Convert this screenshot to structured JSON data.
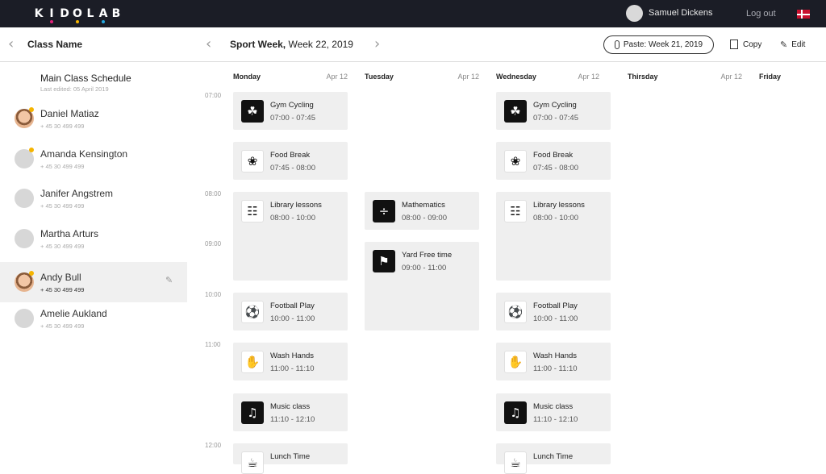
{
  "header": {
    "logo_letters": [
      "K",
      "I",
      "D",
      "O",
      "L",
      "A",
      "B"
    ],
    "user_name": "Samuel Dickens",
    "logout_label": "Log out",
    "colors": {
      "topbar": "#1b1d26",
      "logo_pink": "#e2227a",
      "logo_yellow": "#f5b400",
      "logo_blue": "#25a9e0",
      "flag": "#c8102e"
    }
  },
  "subbar": {
    "back_icon": "chevron-left-icon",
    "class_name": "Class Name",
    "week_bold": "Sport Week,",
    "week_rest": " Week 22, 2019",
    "paste_label": "Paste: Week 21, 2019",
    "copy_label": "Copy",
    "edit_label": "Edit"
  },
  "sidebar": {
    "main_title": "Main Class Schedule",
    "main_subtitle": "Last edited: 05 April 2019",
    "children": [
      {
        "name": "Daniel Matiaz",
        "phone": "+ 45 30 499 499"
      },
      {
        "name": "Amanda Kensington",
        "phone": "+ 45 30 499 499"
      },
      {
        "name": "Janifer Angstrem",
        "phone": "+ 45 30 499 499"
      },
      {
        "name": "Martha Arturs",
        "phone": "+ 45 30 499 499"
      },
      {
        "name": "Andy Bull",
        "phone": "+ 45 30 499 499"
      },
      {
        "name": "Amelie Aukland",
        "phone": "+ 45 30 499 499"
      }
    ]
  },
  "times": [
    "07:00",
    "08:00",
    "09:00",
    "10:00",
    "11:00",
    "12:00"
  ],
  "days": [
    {
      "name": "Monday",
      "date": "Apr 12"
    },
    {
      "name": "Tuesday",
      "date": "Apr 12"
    },
    {
      "name": "Wednesday",
      "date": "Apr 12"
    },
    {
      "name": "Thirsday",
      "date": "Apr 12"
    },
    {
      "name": "Friday",
      "date": ""
    }
  ],
  "events": {
    "monday": [
      {
        "name": "Gym Cycling",
        "time": "07:00 - 07:45",
        "icon": "cycling-icon"
      },
      {
        "name": "Food Break",
        "time": "07:45 - 08:00",
        "icon": "food-icon"
      },
      {
        "name": "Library lessons",
        "time": "08:00 - 10:00",
        "icon": "library-icon"
      },
      {
        "name": "Football Play",
        "time": "10:00 - 11:00",
        "icon": "football-icon"
      },
      {
        "name": "Wash Hands",
        "time": "11:00 - 11:10",
        "icon": "wash-hands-icon"
      },
      {
        "name": "Music class",
        "time": "11:10 - 12:10",
        "icon": "music-icon"
      },
      {
        "name": "Lunch Time",
        "time": "",
        "icon": "lunch-icon"
      }
    ],
    "tuesday": [
      {
        "name": "Mathematics",
        "time": "08:00 - 09:00",
        "icon": "math-icon"
      },
      {
        "name": "Yard Free time",
        "time": "09:00 - 11:00",
        "icon": "yard-icon"
      }
    ],
    "wednesday": [
      {
        "name": "Gym Cycling",
        "time": "07:00 - 07:45",
        "icon": "cycling-icon"
      },
      {
        "name": "Food Break",
        "time": "07:45 - 08:00",
        "icon": "food-icon"
      },
      {
        "name": "Library lessons",
        "time": "08:00 - 10:00",
        "icon": "library-icon"
      },
      {
        "name": "Football Play",
        "time": "10:00 - 11:00",
        "icon": "football-icon"
      },
      {
        "name": "Wash Hands",
        "time": "11:00 - 11:10",
        "icon": "wash-hands-icon"
      },
      {
        "name": "Music class",
        "time": "11:10 - 12:10",
        "icon": "music-icon"
      },
      {
        "name": "Lunch Time",
        "time": "",
        "icon": "lunch-icon"
      }
    ]
  }
}
